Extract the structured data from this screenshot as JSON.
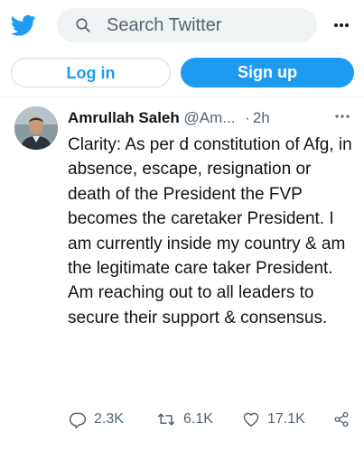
{
  "search": {
    "placeholder": "Search Twitter"
  },
  "auth": {
    "login_label": "Log in",
    "signup_label": "Sign up"
  },
  "tweet": {
    "author_name": "Amrullah Saleh",
    "handle": "@Am...",
    "separator": "·",
    "time": "2h",
    "text": "Clarity: As per d constitution of Afg, in absence, escape, resignation or death of the President the FVP becomes the caretaker President. I am currently inside my country & am the legitimate care taker President. Am reaching out to all leaders to secure their support & consensus.",
    "replies": "2.3K",
    "retweets": "6.1K",
    "likes": "17.1K"
  },
  "colors": {
    "brand": "#1d9bf0",
    "text": "#0f1419",
    "muted": "#536471",
    "search_bg": "#eff3f4"
  },
  "icons": [
    "twitter-bird-icon",
    "search-icon",
    "more-icon",
    "reply-icon",
    "retweet-icon",
    "like-icon",
    "share-icon"
  ]
}
